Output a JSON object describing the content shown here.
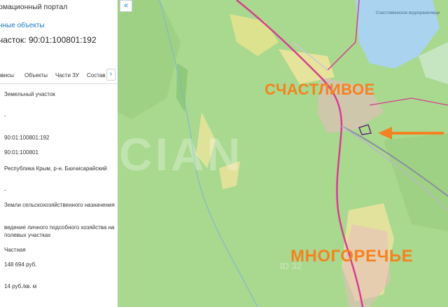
{
  "panel": {
    "portal_title": "рмационный портал",
    "objects_link": "нные объекты",
    "parcel_title": "часток: 90:01:100801:192",
    "tabs": [
      "рвисы",
      "Объекты",
      "Части ЗУ",
      "Состав"
    ],
    "next_icon": "›",
    "rows": [
      "Земельный участок",
      "-",
      "90:01:100801:192",
      "90:01:100801",
      "Республика Крым, р-н. Бахчисарайский",
      "-",
      "Земли сельскохозяйственного назначения",
      "ведение личного подсобного хозяйства на полевых участках",
      "Частная",
      "148 694 руб.",
      "14 руб./кв. м"
    ]
  },
  "map": {
    "collapse_icon": "«",
    "town_1": "СЧАСТЛИВОЕ",
    "town_2": "МНОГОРЕЧЬЕ",
    "watermark": "CIAN",
    "watermark_id": "ID 32",
    "lake_label": "Счастливенское водохранилище",
    "colors": {
      "forest": "#a9d88f",
      "lake": "#aad3f0",
      "road": "#d63d8f",
      "arrow": "#f5821f",
      "label": "#f5821f"
    }
  }
}
